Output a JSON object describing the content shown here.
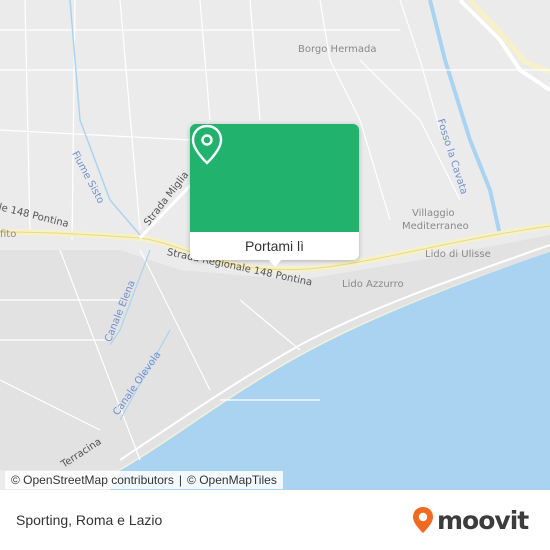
{
  "map": {
    "labels": {
      "borgo_hermada": "Borgo Hermada",
      "fiume_sisto": "Fiume Sisto",
      "fosso_la_cavata": "Fosso la Cavata",
      "villaggio_line1": "Villaggio",
      "villaggio_line2": "Mediterraneo",
      "lido_di_ulisse": "Lido di Ulisse",
      "lido_azzurro": "Lido Azzurro",
      "strada_miglia": "Strada Miglia",
      "strada_regionale_left": "le 148 Pontina",
      "strada_regionale_right": "Strada Regionale 148 Pontina",
      "canale_elena": "Canale Elena",
      "canale_olevola": "Canale Olevola",
      "terracina": "Terracina",
      "fito": "fito"
    }
  },
  "popup": {
    "button_label": "Portami lì",
    "icon": "map-pin-icon",
    "color": "#21b36e"
  },
  "attribution": {
    "osm_link": "© OpenStreetMap contributors",
    "separator": "|",
    "omt_link": "© OpenMapTiles"
  },
  "footer": {
    "place_name": "Sporting, Roma e Lazio",
    "logo_text": "moovit",
    "logo_color": "#f26a21"
  }
}
